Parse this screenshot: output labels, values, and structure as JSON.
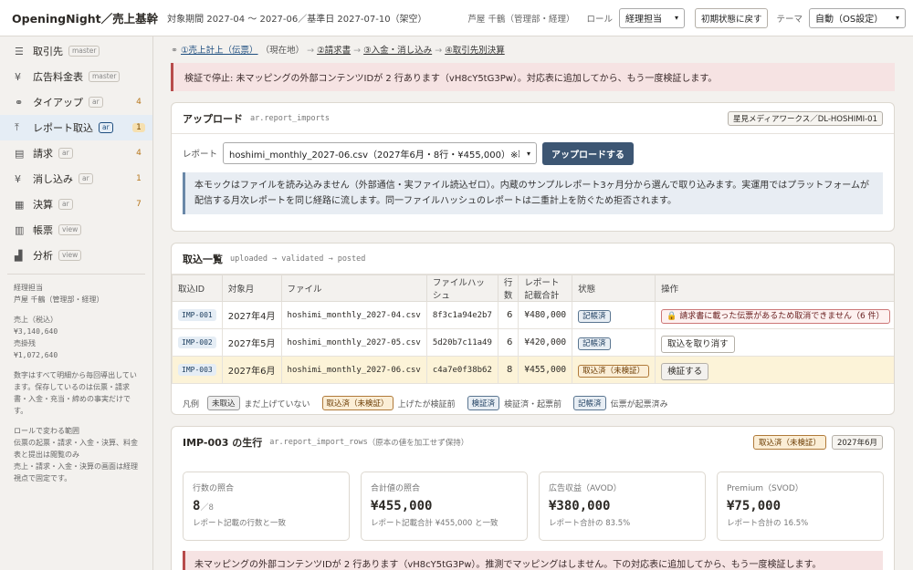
{
  "topbar": {
    "brand": "OpeningNight／売上基幹",
    "period": "対象期間 2027-04 ～ 2027-06／基準日 2027-07-10（架空）",
    "user": "芦屋 千鶴（管理部・経理）",
    "role_label": "ロール",
    "role_value": "経理担当",
    "reset_label": "初期状態に戻す",
    "theme_label": "テーマ",
    "theme_value": "自動（OS設定）"
  },
  "sidebar": {
    "items": [
      {
        "icon": "database-icon",
        "glyph": "☰",
        "label": "取引先",
        "chip": "master",
        "count": ""
      },
      {
        "icon": "yen-icon",
        "glyph": "¥",
        "label": "広告料金表",
        "chip": "master",
        "count": ""
      },
      {
        "icon": "link-icon",
        "glyph": "⚭",
        "label": "タイアップ",
        "chip": "ar",
        "count": "4"
      },
      {
        "icon": "upload-icon",
        "glyph": "⤒",
        "label": "レポート取込",
        "chip": "ar",
        "count": "1"
      },
      {
        "icon": "document-icon",
        "glyph": "▤",
        "label": "請求",
        "chip": "ar",
        "count": "4"
      },
      {
        "icon": "yen-icon",
        "glyph": "¥",
        "label": "消し込み",
        "chip": "ar",
        "count": "1"
      },
      {
        "icon": "grid-icon",
        "glyph": "▦",
        "label": "決算",
        "chip": "ar",
        "count": "7"
      },
      {
        "icon": "book-icon",
        "glyph": "▥",
        "label": "帳票",
        "chip": "view",
        "count": ""
      },
      {
        "icon": "chart-icon",
        "glyph": "▟",
        "label": "分析",
        "chip": "view",
        "count": ""
      }
    ],
    "info": {
      "role": "経理担当",
      "user": "芦屋 千鶴（管理部・経理）",
      "sales_label": "売上（税込）",
      "sales_value": "¥3,140,640",
      "receivable_label": "売掛残",
      "receivable_value": "¥1,072,640",
      "note1": "数字はすべて明細から毎回導出しています。保存しているのは伝票・請求書・入金・充当・締めの事実だけです。",
      "note2_title": "ロールで変わる範囲",
      "note2": "伝票の起票・請求・入金・決算、料金表と提出は閲覧のみ",
      "note3": "売上・請求・入金・決算の画面は経理視点で固定です。"
    }
  },
  "breadcrumb": {
    "step1": "①売上計上（伝票）",
    "current": "（現在地）",
    "step2": "②請求書",
    "step3": "③入金・消し込み",
    "step4": "④取引先別決算"
  },
  "banner": "検証で停止: 未マッピングの外部コンテンツIDが 2 行あります（vH8cY5tG3Pw）。対応表に追加してから、もう一度検証します。",
  "upload": {
    "title": "アップロード",
    "table_name": "ar.report_imports",
    "partner_tag": "星見メディアワークス／DL-HOSHIMI-01",
    "report_label": "レポート",
    "report_value": "hoshimi_monthly_2027-06.csv（2027年6月・8行・¥455,000）※取込済",
    "upload_button": "アップロードする",
    "info": "本モックはファイルを読み込みません（外部通信・実ファイル読込ゼロ）。内蔵のサンプルレポート3ヶ月分から選んで取り込みます。実運用ではプラットフォームが配信する月次レポートを同じ経路に流します。同一ファイルハッシュのレポートは二重計上を防ぐため拒否されます。"
  },
  "imports": {
    "title": "取込一覧",
    "flow": "uploaded → validated → posted",
    "headers": [
      "取込ID",
      "対象月",
      "ファイル",
      "ファイルハッシュ",
      "行数",
      "レポート記載合計",
      "状態",
      "操作"
    ],
    "rows": [
      {
        "id": "IMP-001",
        "month": "2027年4月",
        "file": "hoshimi_monthly_2027-04.csv",
        "hash": "8f3c1a94e2b7",
        "rows": "6",
        "total": "¥480,000",
        "status": "記帳済",
        "action": "🔒 請求書に載った伝票があるため取消できません（6 件）"
      },
      {
        "id": "IMP-002",
        "month": "2027年5月",
        "file": "hoshimi_monthly_2027-05.csv",
        "hash": "5d20b7c11a49",
        "rows": "6",
        "total": "¥420,000",
        "status": "記帳済",
        "action": "取込を取り消す"
      },
      {
        "id": "IMP-003",
        "month": "2027年6月",
        "file": "hoshimi_monthly_2027-06.csv",
        "hash": "c4a7e0f38b62",
        "rows": "8",
        "total": "¥455,000",
        "status": "取込済（未検証）",
        "action": "検証する"
      }
    ],
    "legend": {
      "label": "凡例",
      "s1": "未取込",
      "d1": "まだ上げていない",
      "s2": "取込済（未検証）",
      "d2": "上げたが検証前",
      "s3": "検証済",
      "d3": "検証済・起票前",
      "s4": "記帳済",
      "d4": "伝票が起票済み"
    }
  },
  "detail": {
    "title": "IMP-003 の生行",
    "table_name": "ar.report_import_rows",
    "note": "（原本の値を加工せず保持）",
    "status": "取込済（未検証）",
    "month": "2027年6月",
    "stats": [
      {
        "label": "行数の照合",
        "value": "8",
        "denom": "／8",
        "note": "レポート記載の行数と一致"
      },
      {
        "label": "合計値の照合",
        "value": "¥455,000",
        "denom": "",
        "note": "レポート記載合計 ¥455,000 と一致"
      },
      {
        "label": "広告収益（AVOD）",
        "value": "¥380,000",
        "denom": "",
        "note": "レポート合計の 83.5%"
      },
      {
        "label": "Premium（SVOD）",
        "value": "¥75,000",
        "denom": "",
        "note": "レポート合計の 16.5%"
      }
    ],
    "warning": "未マッピングの外部コンテンツIDが 2 行あります（vH8cY5tG3Pw）。推測でマッピングはしません。下の対応表に追加してから、もう一度検証します。"
  }
}
